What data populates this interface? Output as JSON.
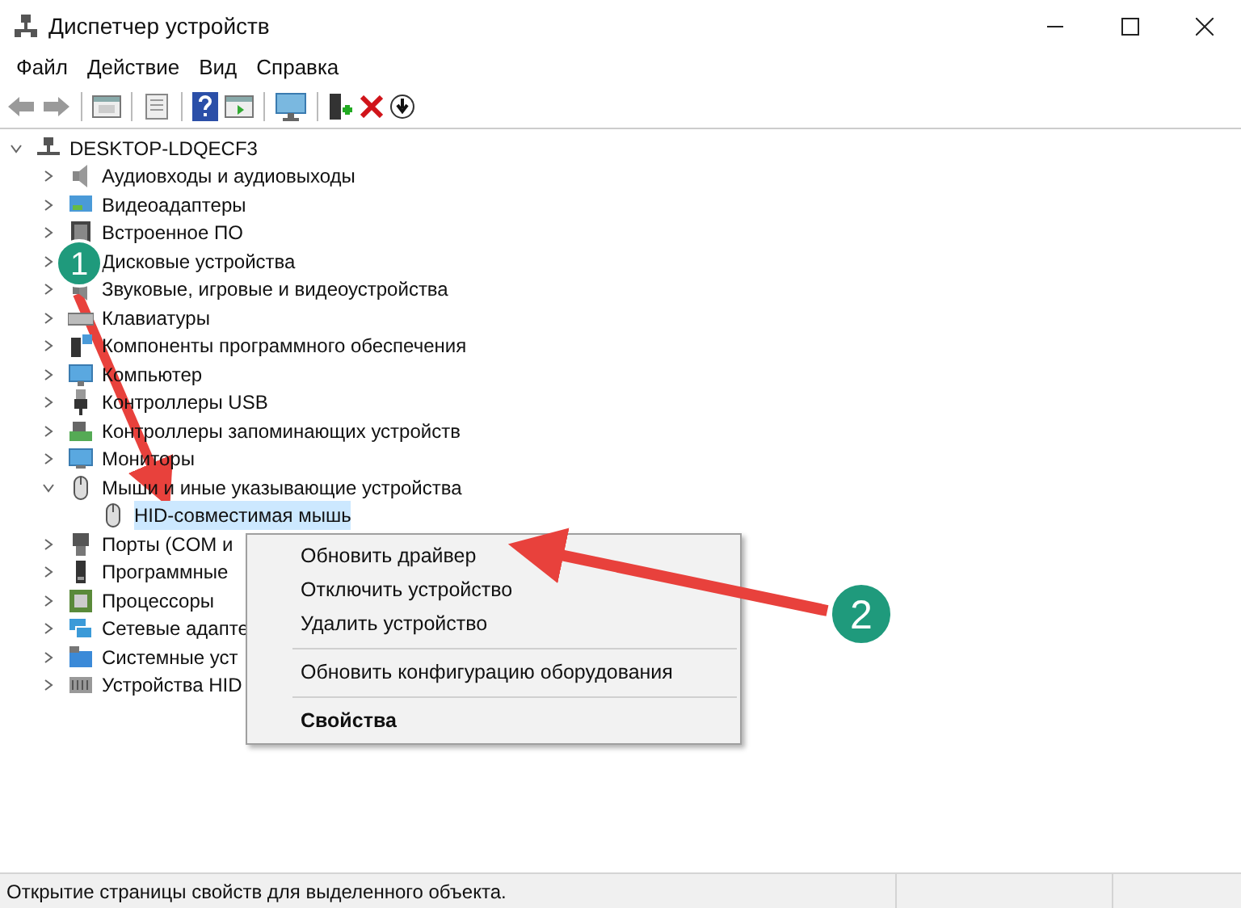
{
  "window": {
    "title": "Диспетчер устройств"
  },
  "menu": [
    "Файл",
    "Действие",
    "Вид",
    "Справка"
  ],
  "tree": {
    "label": "DESKTOP-LDQECF3",
    "expanded": true,
    "children": [
      {
        "label": "Аудиовходы и аудиовыходы",
        "expanded": false
      },
      {
        "label": "Видеоадаптеры",
        "expanded": false
      },
      {
        "label": "Встроенное ПО",
        "expanded": false
      },
      {
        "label": "Дисковые устройства",
        "expanded": false
      },
      {
        "label": "Звуковые, игровые и видеоустройства",
        "expanded": false
      },
      {
        "label": "Клавиатуры",
        "expanded": false
      },
      {
        "label": "Компоненты программного обеспечения",
        "expanded": false
      },
      {
        "label": "Компьютер",
        "expanded": false
      },
      {
        "label": "Контроллеры USB",
        "expanded": false
      },
      {
        "label": "Контроллеры запоминающих устройств",
        "expanded": false
      },
      {
        "label": "Мониторы",
        "expanded": false
      },
      {
        "label": "Мыши и иные указывающие устройства",
        "expanded": true,
        "children": [
          {
            "label": "HID-совместимая мышь",
            "selected": true
          }
        ]
      },
      {
        "label": "Порты (COM и",
        "expanded": false
      },
      {
        "label": "Программные",
        "expanded": false
      },
      {
        "label": "Процессоры",
        "expanded": false
      },
      {
        "label": "Сетевые адапте",
        "expanded": false
      },
      {
        "label": "Системные уст",
        "expanded": false
      },
      {
        "label": "Устройства HID",
        "expanded": false
      }
    ]
  },
  "context_menu": [
    {
      "kind": "item",
      "label": "Обновить драйвер",
      "default": false
    },
    {
      "kind": "item",
      "label": "Отключить устройство",
      "default": false
    },
    {
      "kind": "item",
      "label": "Удалить устройство",
      "default": false
    },
    {
      "kind": "separator"
    },
    {
      "kind": "item",
      "label": "Обновить конфигурацию оборудования",
      "default": false
    },
    {
      "kind": "separator"
    },
    {
      "kind": "item",
      "label": "Свойства",
      "default": true
    }
  ],
  "annotations": [
    "1",
    "2"
  ],
  "status_bar": "Открытие страницы свойств для выделенного объекта."
}
